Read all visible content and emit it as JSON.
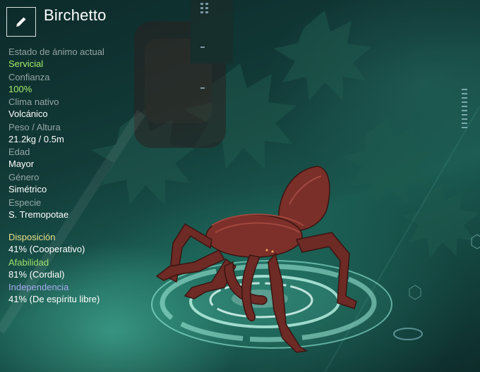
{
  "creature": {
    "name": "Birchetto"
  },
  "stats": [
    {
      "label": "Estado de ánimo actual",
      "value": "Servicial"
    },
    {
      "label": "Confianza",
      "value": "100%"
    },
    {
      "label": "Clima nativo",
      "value": "Volcánico"
    },
    {
      "label": "Peso / Altura",
      "value": "21.2kg / 0.5m"
    },
    {
      "label": "Edad",
      "value": "Mayor"
    },
    {
      "label": "Género",
      "value": "Simétrico"
    },
    {
      "label": "Especie",
      "value": "S. Tremopotae"
    }
  ],
  "traits": [
    {
      "label": "Disposición",
      "value": "41% (Cooperativo)",
      "color": "#e9e28a"
    },
    {
      "label": "Afabilidad",
      "value": "81% (Cordial)",
      "color": "#9ee069"
    },
    {
      "label": "Independencia",
      "value": "41% (De espíritu libre)",
      "color": "#a9a9f0"
    }
  ],
  "colors": {
    "accent_green": "#a6ec6c",
    "hologram": "#8ff3dc",
    "creature": "#6e2a25"
  },
  "icons": {
    "edit": "pencil-icon"
  }
}
